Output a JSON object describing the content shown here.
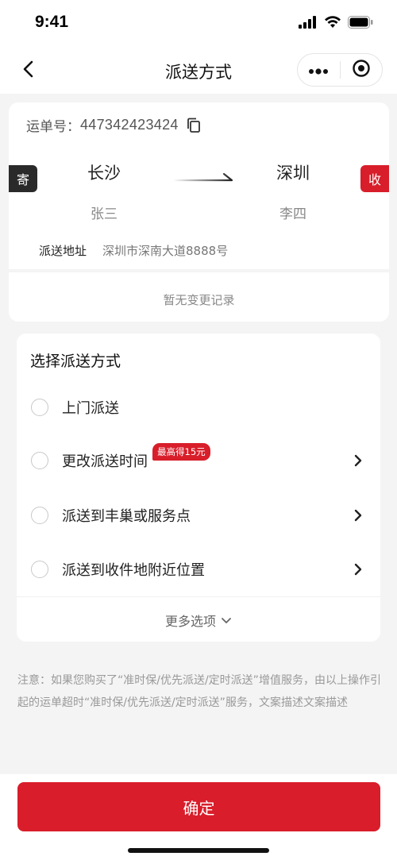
{
  "status_bar": {
    "time": "9:41"
  },
  "nav": {
    "title": "派送方式"
  },
  "shipment": {
    "waybill_label": "运单号：",
    "waybill_number": "447342423424",
    "send_tag": "寄",
    "receive_tag": "收",
    "from_city": "长沙",
    "to_city": "深圳",
    "sender": "张三",
    "receiver": "李四",
    "address_label": "派送地址",
    "address_value": "深圳市深南大道8888号",
    "no_record_text": "暂无变更记录"
  },
  "delivery": {
    "section_title": "选择派送方式",
    "options": [
      {
        "label": "上门派送",
        "badge": "",
        "has_chevron": false
      },
      {
        "label": "更改派送时间",
        "badge": "最高得15元",
        "has_chevron": true
      },
      {
        "label": "派送到丰巢或服务点",
        "badge": "",
        "has_chevron": true
      },
      {
        "label": "派送到收件地附近位置",
        "badge": "",
        "has_chevron": true
      }
    ],
    "more_label": "更多选项"
  },
  "note": "注意：如果您购买了“准时保/优先派送/定时派送”增值服务，由以上操作引起的运单超时“准时保/优先派送/定时派送”服务，文案描述文案描述",
  "footer": {
    "confirm_label": "确定"
  },
  "colors": {
    "accent": "#d91d2a",
    "dark_tag": "#2a2a2a",
    "background": "#f4f4f4"
  },
  "icons": [
    "signal-icon",
    "wifi-icon",
    "battery-icon",
    "back-arrow-icon",
    "more-dots-icon",
    "close-target-icon",
    "copy-icon",
    "route-arrow-icon",
    "chevron-right-icon",
    "chevron-down-icon"
  ]
}
